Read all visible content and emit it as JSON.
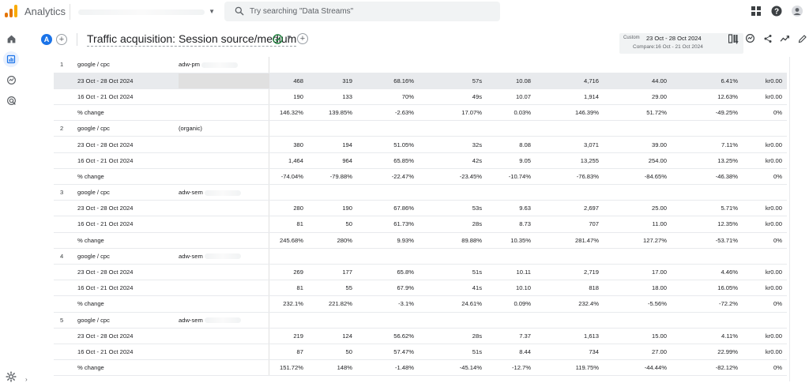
{
  "app": {
    "title": "Analytics",
    "search_placeholder": "Try searching \"Data Streams\""
  },
  "report": {
    "comparison_badge": "A",
    "title": "Traffic acquisition: Session source/medium",
    "date": {
      "badge": "Custom",
      "range": "23 Oct - 28 Oct 2024",
      "compare": "Compare:16 Oct - 21 Oct 2024"
    }
  },
  "colors": {
    "accent": "#1a73e8",
    "logo": [
      "#f9ab00",
      "#e37400",
      "#e37400"
    ],
    "row_highlight": "#e8eaed"
  },
  "table": {
    "groups": [
      {
        "index": "1",
        "source": "google / cpc",
        "campaign": "adw-pm",
        "rows": [
          {
            "label": "23 Oct - 28 Oct 2024",
            "values": [
              "468",
              "319",
              "68.16%",
              "57s",
              "10.08",
              "4,716",
              "44.00",
              "6.41%",
              "kr0.00"
            ]
          },
          {
            "label": "16 Oct - 21 Oct 2024",
            "values": [
              "190",
              "133",
              "70%",
              "49s",
              "10.07",
              "1,914",
              "29.00",
              "12.63%",
              "kr0.00"
            ]
          },
          {
            "label": "% change",
            "values": [
              "146.32%",
              "139.85%",
              "-2.63%",
              "17.07%",
              "0.03%",
              "146.39%",
              "51.72%",
              "-49.25%",
              "0%"
            ]
          }
        ]
      },
      {
        "index": "2",
        "source": "google / cpc",
        "campaign": "(organic)",
        "rows": [
          {
            "label": "23 Oct - 28 Oct 2024",
            "values": [
              "380",
              "194",
              "51.05%",
              "32s",
              "8.08",
              "3,071",
              "39.00",
              "7.11%",
              "kr0.00"
            ]
          },
          {
            "label": "16 Oct - 21 Oct 2024",
            "values": [
              "1,464",
              "964",
              "65.85%",
              "42s",
              "9.05",
              "13,255",
              "254.00",
              "13.25%",
              "kr0.00"
            ]
          },
          {
            "label": "% change",
            "values": [
              "-74.04%",
              "-79.88%",
              "-22.47%",
              "-23.45%",
              "-10.74%",
              "-76.83%",
              "-84.65%",
              "-46.38%",
              "0%"
            ]
          }
        ]
      },
      {
        "index": "3",
        "source": "google / cpc",
        "campaign": "adw-sem",
        "rows": [
          {
            "label": "23 Oct - 28 Oct 2024",
            "values": [
              "280",
              "190",
              "67.86%",
              "53s",
              "9.63",
              "2,697",
              "25.00",
              "5.71%",
              "kr0.00"
            ]
          },
          {
            "label": "16 Oct - 21 Oct 2024",
            "values": [
              "81",
              "50",
              "61.73%",
              "28s",
              "8.73",
              "707",
              "11.00",
              "12.35%",
              "kr0.00"
            ]
          },
          {
            "label": "% change",
            "values": [
              "245.68%",
              "280%",
              "9.93%",
              "89.88%",
              "10.35%",
              "281.47%",
              "127.27%",
              "-53.71%",
              "0%"
            ]
          }
        ]
      },
      {
        "index": "4",
        "source": "google / cpc",
        "campaign": "adw-sem",
        "rows": [
          {
            "label": "23 Oct - 28 Oct 2024",
            "values": [
              "269",
              "177",
              "65.8%",
              "51s",
              "10.11",
              "2,719",
              "17.00",
              "4.46%",
              "kr0.00"
            ]
          },
          {
            "label": "16 Oct - 21 Oct 2024",
            "values": [
              "81",
              "55",
              "67.9%",
              "41s",
              "10.10",
              "818",
              "18.00",
              "16.05%",
              "kr0.00"
            ]
          },
          {
            "label": "% change",
            "values": [
              "232.1%",
              "221.82%",
              "-3.1%",
              "24.61%",
              "0.09%",
              "232.4%",
              "-5.56%",
              "-72.2%",
              "0%"
            ]
          }
        ]
      },
      {
        "index": "5",
        "source": "google / cpc",
        "campaign": "adw-sem",
        "rows": [
          {
            "label": "23 Oct - 28 Oct 2024",
            "values": [
              "219",
              "124",
              "56.62%",
              "28s",
              "7.37",
              "1,613",
              "15.00",
              "4.11%",
              "kr0.00"
            ]
          },
          {
            "label": "16 Oct - 21 Oct 2024",
            "values": [
              "87",
              "50",
              "57.47%",
              "51s",
              "8.44",
              "734",
              "27.00",
              "22.99%",
              "kr0.00"
            ]
          },
          {
            "label": "% change",
            "values": [
              "151.72%",
              "148%",
              "-1.48%",
              "-45.14%",
              "-12.7%",
              "119.75%",
              "-44.44%",
              "-82.12%",
              "0%"
            ]
          }
        ]
      }
    ]
  }
}
